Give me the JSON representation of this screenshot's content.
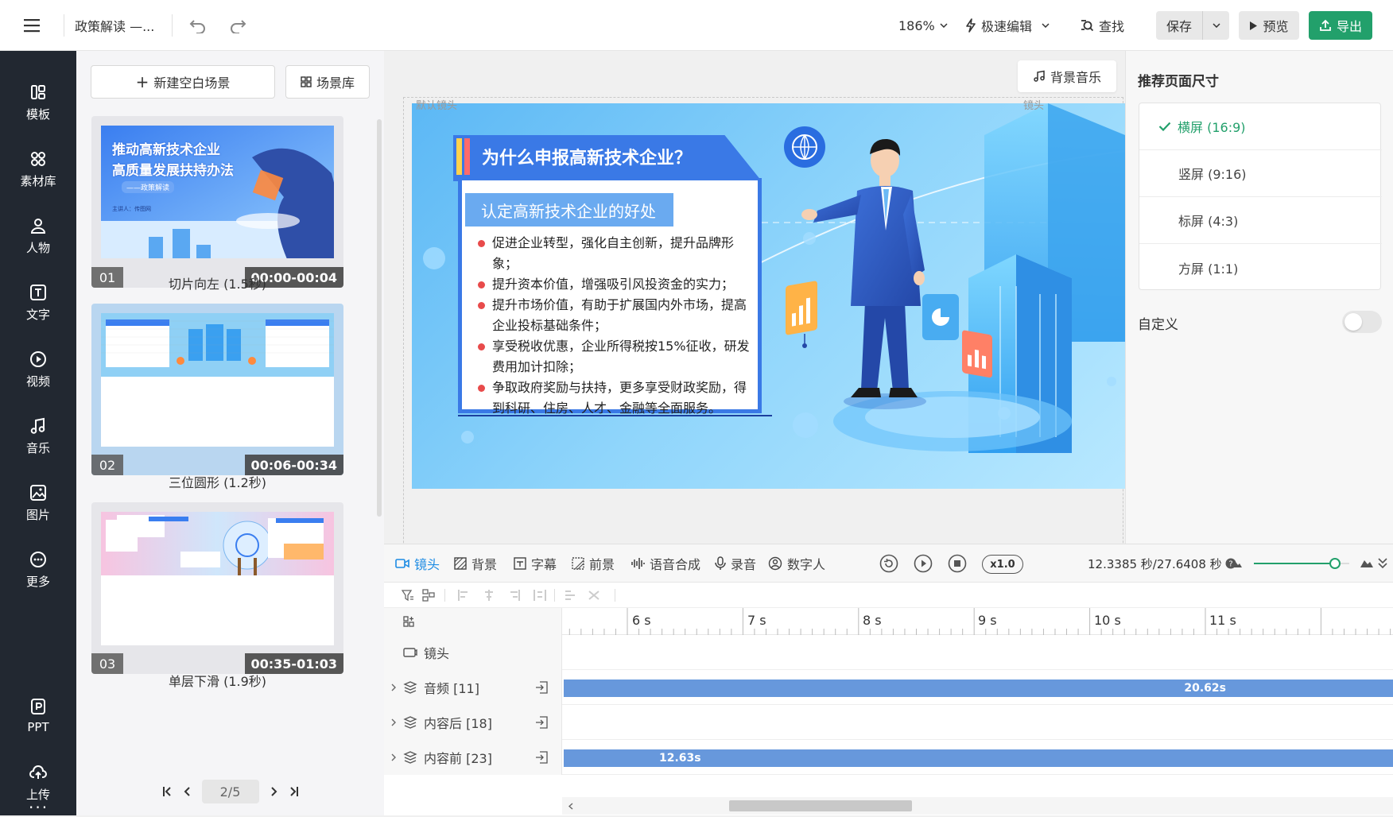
{
  "header": {
    "doc_title": "政策解读 —...",
    "zoom": "186%",
    "speed_edit": "极速编辑",
    "find": "查找",
    "save": "保存",
    "preview": "预览",
    "export": "导出",
    "accent_color": "#22a06b"
  },
  "sidebar": {
    "items": [
      {
        "label": "模板",
        "icon": "layout-icon"
      },
      {
        "label": "素材库",
        "icon": "grid-icon"
      },
      {
        "label": "人物",
        "icon": "person-icon"
      },
      {
        "label": "文字",
        "icon": "text-icon"
      },
      {
        "label": "视频",
        "icon": "video-icon"
      },
      {
        "label": "音乐",
        "icon": "music-icon"
      },
      {
        "label": "图片",
        "icon": "image-icon"
      },
      {
        "label": "更多",
        "icon": "more-icon"
      },
      {
        "label": "PPT",
        "icon": "ppt-icon"
      },
      {
        "label": "上传",
        "icon": "upload-icon"
      }
    ]
  },
  "scenes": {
    "new_blank": "新建空白场景",
    "library": "场景库",
    "items": [
      {
        "num": "01",
        "time": "00:00-00:04",
        "caption": "切片向左 (1.5秒)",
        "thumb_title": "推动高新技术企业",
        "thumb_title2": "高质量发展扶持办法",
        "thumb_sub": "——政策解读",
        "thumb_speaker": "主讲人：传图网"
      },
      {
        "num": "02",
        "time": "00:06-00:34",
        "caption": "三位圆形 (1.2秒)"
      },
      {
        "num": "03",
        "time": "00:35-01:03",
        "caption": "单层下滑 (1.9秒)"
      }
    ],
    "pager": "2/5"
  },
  "canvas": {
    "bgm_button": "背景音乐",
    "default_lens": "默认镜头",
    "lens_right": "镜头",
    "slide": {
      "title": "为什么申报高新技术企业？",
      "subtitle": "认定高新技术企业的好处",
      "bullets": [
        "促进企业转型，强化自主创新，提升品牌形象；",
        "提升资本价值，增强吸引风投资金的实力；",
        "提升市场价值，有助于扩展国内外市场，提高企业投标基础条件；",
        "享受税收优惠，企业所得税按15%征收，研发费用加计扣除；",
        "争取政府奖励与扶持，更多享受财政奖励，得到科研、住房、人才、金融等全面服务。"
      ]
    }
  },
  "page_size": {
    "title": "推荐页面尺寸",
    "options": [
      "横屏 (16:9)",
      "竖屏 (9:16)",
      "标屏 (4:3)",
      "方屏 (1:1)"
    ],
    "selected": "横屏 (16:9)",
    "custom_label": "自定义",
    "custom_enabled": false
  },
  "timeline": {
    "tabs": [
      "镜头",
      "背景",
      "字幕",
      "前景",
      "语音合成",
      "录音",
      "数字人"
    ],
    "active_tab": "镜头",
    "speed": "x1.0",
    "time": "12.3385 秒/27.6408 秒",
    "zoom_level": 0.85,
    "ruler_ticks": [
      "6 s",
      "7 s",
      "8 s",
      "9 s",
      "10 s",
      "11 s"
    ],
    "tracks": [
      {
        "label": "镜头",
        "bar": ""
      },
      {
        "label": "音频 [11]",
        "bar": "20.62s"
      },
      {
        "label": "内容后 [18]",
        "bar": ""
      },
      {
        "label": "内容前 [23]",
        "bar": "12.63s"
      }
    ],
    "bar_color": "#6798dc"
  }
}
